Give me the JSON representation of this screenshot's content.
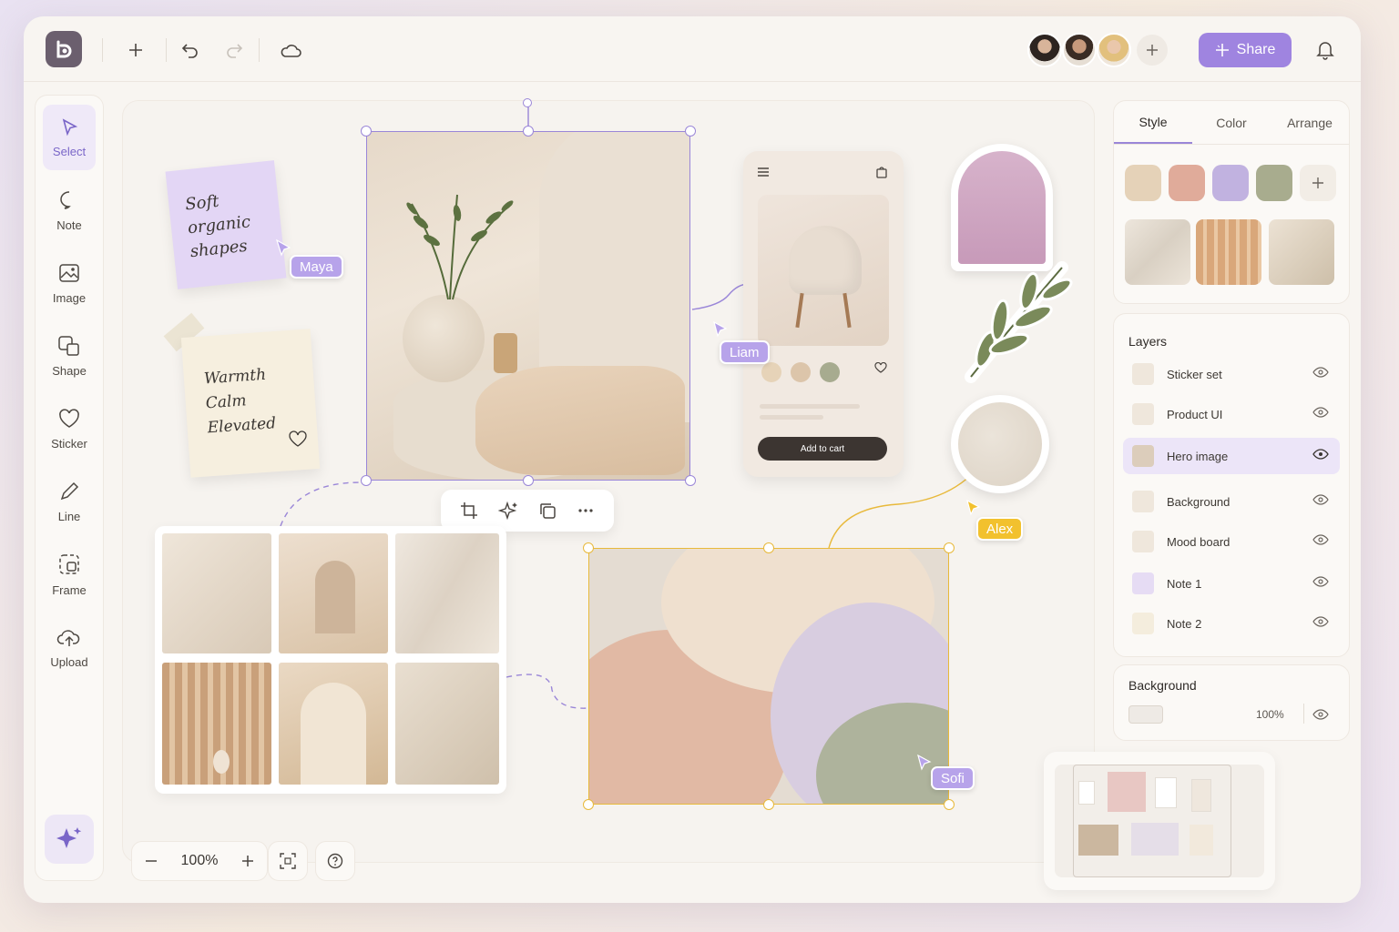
{
  "topbar": {
    "icons": [
      "logo-icon",
      "plus-icon",
      "undo-icon",
      "redo-icon",
      "cloud-icon",
      "bell-icon"
    ],
    "share_label": "Share",
    "avatar_count": 3
  },
  "tools": [
    {
      "label": "Select",
      "icon": "cursor-icon",
      "active": true
    },
    {
      "label": "Note",
      "icon": "speech-bubble-icon"
    },
    {
      "label": "Image",
      "icon": "image-icon"
    },
    {
      "label": "Shape",
      "icon": "shapes-icon"
    },
    {
      "label": "Sticker",
      "icon": "heart-icon"
    },
    {
      "label": "Line",
      "icon": "pencil-icon"
    },
    {
      "label": "Frame",
      "icon": "frame-icon"
    },
    {
      "label": "Upload",
      "icon": "upload-cloud-icon"
    }
  ],
  "canvas": {
    "note1_lines": [
      "Soft",
      "organic",
      "shapes"
    ],
    "note2_lines": [
      "Warmth",
      "Calm",
      "Elevated"
    ],
    "cursors": {
      "maya": "Maya",
      "liam": "Liam",
      "alex": "Alex",
      "sofi": "Sofi"
    },
    "phone": {
      "cta": "Add to cart"
    },
    "zoom": "100%"
  },
  "panel": {
    "tabs": [
      "Style",
      "Color",
      "Arrange"
    ],
    "active_tab": "Style",
    "swatches": [
      "#e5d2b8",
      "#e0ab9a",
      "#c1b2e0",
      "#a8ac8e"
    ]
  },
  "layers": {
    "title": "Layers",
    "items": [
      "Sticker set",
      "Product UI",
      "Hero image",
      "Background",
      "Mood board",
      "Note 1",
      "Note 2"
    ],
    "active": "Hero image"
  },
  "background": {
    "title": "Background",
    "opacity": "100%"
  },
  "colors": {
    "accent": "#9f84e0",
    "alex": "#f2c12e",
    "selection": "#9a86d8"
  }
}
